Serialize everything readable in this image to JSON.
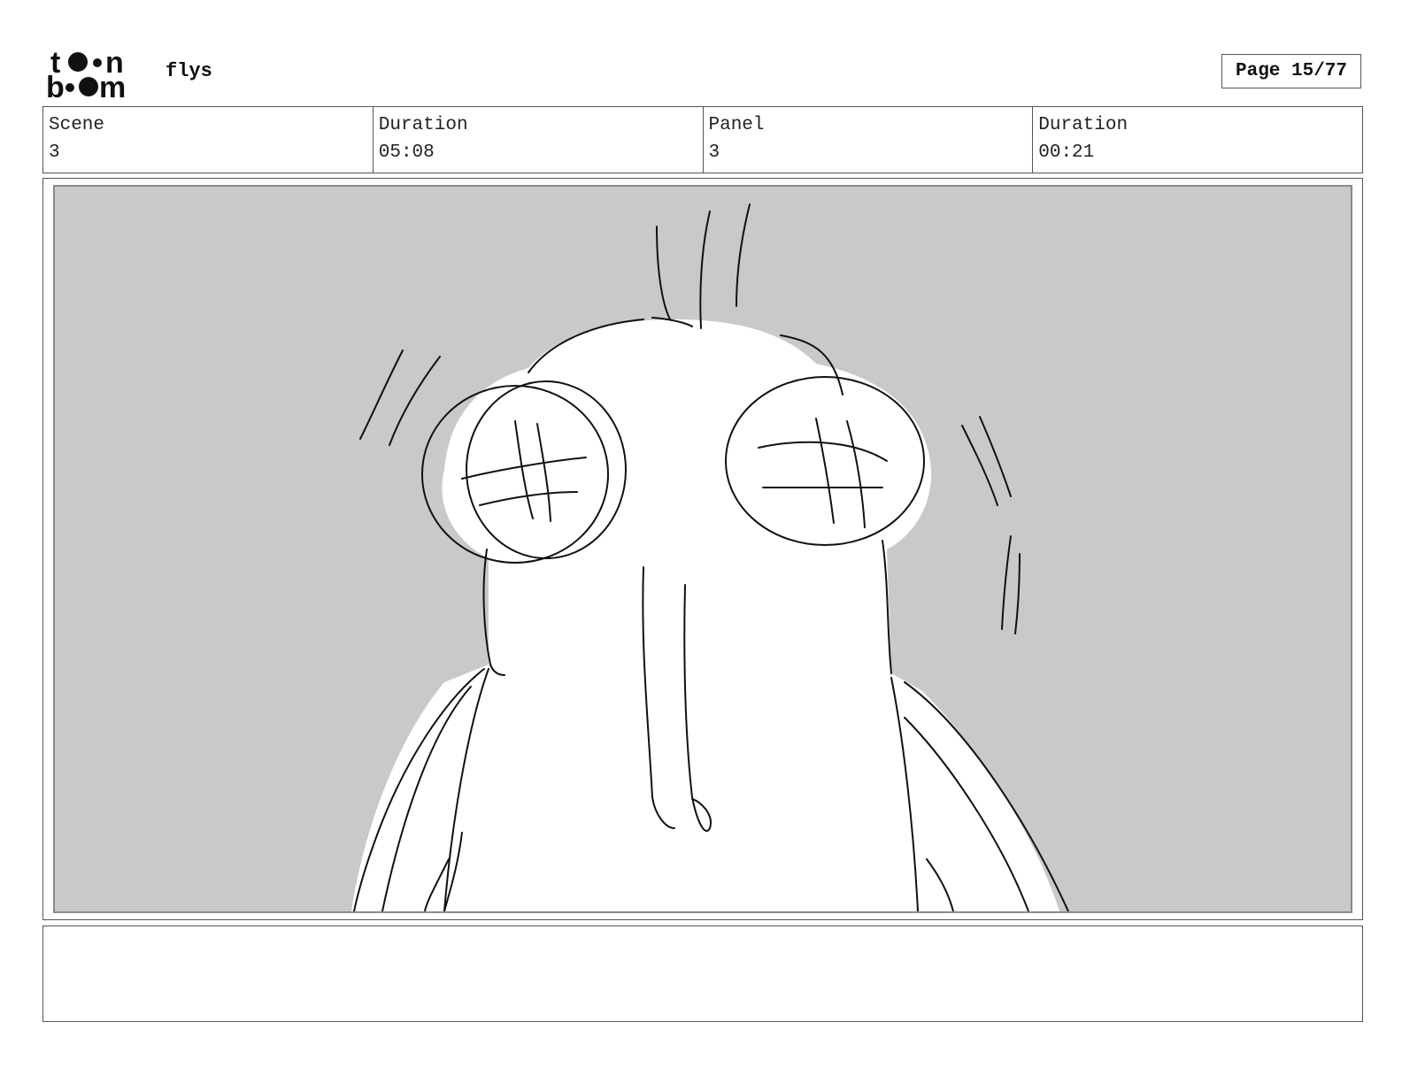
{
  "header": {
    "logo_text": "toon boom",
    "logo_icon": "toon-boom-logo",
    "project_name": "flys",
    "page_counter": "Page 15/77"
  },
  "info": {
    "scene_label": "Scene",
    "scene_value": "3",
    "scene_duration_label": "Duration",
    "scene_duration_value": "05:08",
    "panel_label": "Panel",
    "panel_value": "3",
    "panel_duration_label": "Duration",
    "panel_duration_value": "00:21"
  },
  "panel": {
    "description": "",
    "background_color": "#c9c9c9"
  },
  "notes": {
    "text": ""
  }
}
